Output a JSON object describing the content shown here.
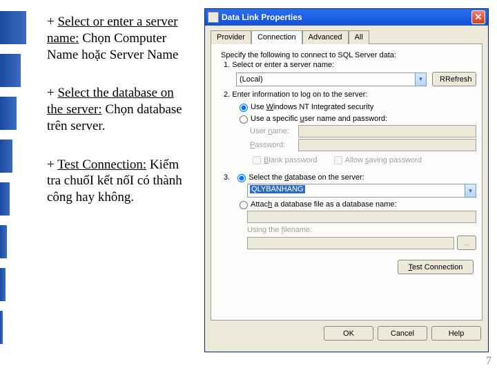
{
  "page_number": "7",
  "notes": {
    "n1_a": "+ ",
    "n1_b": "Select or enter a server name:",
    "n1_c": " Chọn Computer Name hoặc Server Name",
    "n2_a": "+ ",
    "n2_b": "Select the database on the server:",
    "n2_c": " Chọn database trên server.",
    "n3_a": "+ ",
    "n3_b": "Test Connection:",
    "n3_c": " Kiểm tra chuổI kết nốI có thành công hay không."
  },
  "dialog": {
    "title": "Data Link Properties",
    "tabs": {
      "provider": "Provider",
      "connection": "Connection",
      "advanced": "Advanced",
      "all": "All"
    },
    "intro": "Specify the following to connect to SQL Server data:",
    "step1_label": "1. Select or enter a server name:",
    "server_value": "(Local)",
    "refresh": "Refresh",
    "step2_label": "2. Enter information to log on to the server:",
    "radio_nt_a": "Use ",
    "radio_nt_b": "W",
    "radio_nt_c": "indows NT Integrated security",
    "radio_user_a": "Use a specific ",
    "radio_user_b": "u",
    "radio_user_c": "ser name and password:",
    "user_label_a": "User ",
    "user_label_b": "n",
    "user_label_c": "ame:",
    "pass_label_a": "P",
    "pass_label_b": "assword:",
    "blank_pw_a": "B",
    "blank_pw_b": "lank password",
    "allow_save_a": "Allow ",
    "allow_save_b": "s",
    "allow_save_c": "aving password",
    "step3_radio_a": "3.",
    "step3_radio_b": "Select the ",
    "step3_radio_c": "d",
    "step3_radio_d": "atabase on the server:",
    "db_value": "QLYBANHANG",
    "attach_radio_a": "Attac",
    "attach_radio_b": "h",
    "attach_radio_c": " a database file as a database name:",
    "using_file_a": "Using the ",
    "using_file_b": "f",
    "using_file_c": "ilename:",
    "browse": "...",
    "test_conn_a": "T",
    "test_conn_b": "est Connection",
    "ok": "OK",
    "cancel": "Cancel",
    "help": "Help"
  }
}
